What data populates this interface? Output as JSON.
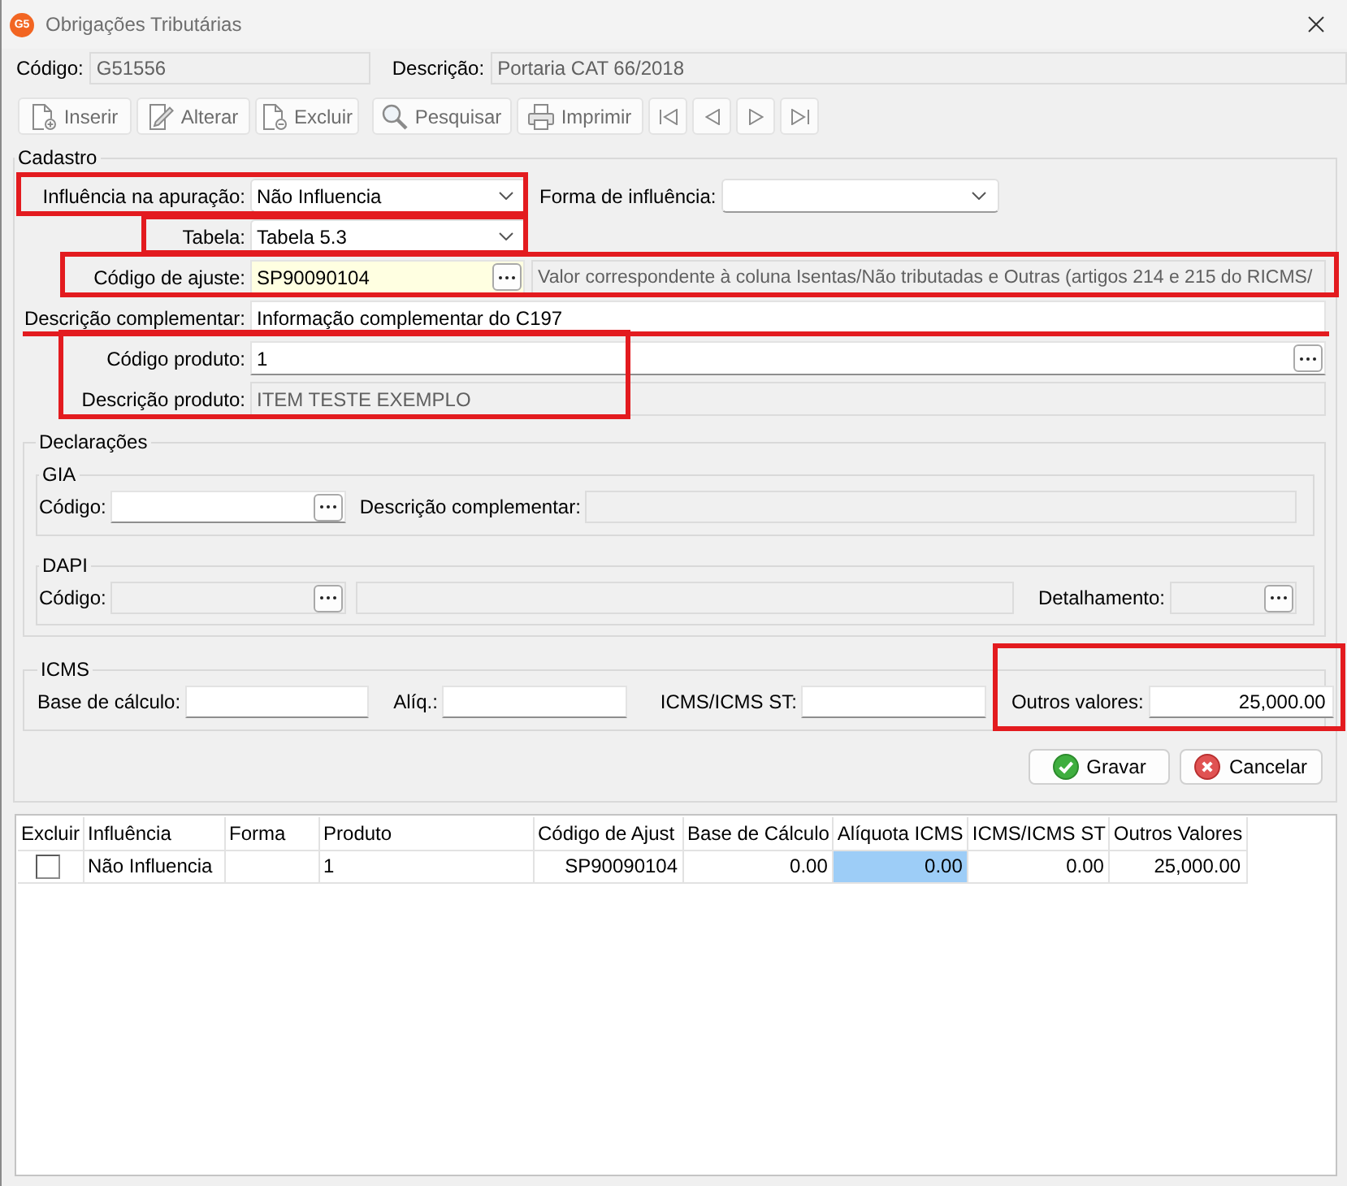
{
  "window": {
    "logo": "G5",
    "title": "Obrigações Tributárias"
  },
  "header": [
    {
      "label": "Código:",
      "value": "G51556",
      "disabled": true
    },
    {
      "label": "Descrição:",
      "value": "Portaria CAT 66/2018",
      "disabled": true
    }
  ],
  "toolbar": [
    {
      "kind": "insert",
      "label": "Inserir",
      "disabled": true
    },
    {
      "kind": "edit",
      "label": "Alterar",
      "disabled": true
    },
    {
      "kind": "delete",
      "label": "Excluir",
      "disabled": true
    },
    {
      "kind": "search",
      "label": "Pesquisar",
      "disabled": true
    },
    {
      "kind": "print",
      "label": "Imprimir",
      "disabled": true
    },
    {
      "kind": "first",
      "disabled": true
    },
    {
      "kind": "previous",
      "disabled": true
    },
    {
      "kind": "next",
      "disabled": true
    },
    {
      "kind": "last",
      "disabled": true
    }
  ],
  "cadastro": {
    "title": "Cadastro",
    "influencia": {
      "label": "Influência na apuração:",
      "value": "Não Influencia",
      "highlighted": true
    },
    "forma": {
      "label": "Forma de influência:"
    },
    "tabela": {
      "label": "Tabela:",
      "value": "Tabela 5.3",
      "highlighted": true
    },
    "codigo_ajuste": {
      "label": "Código de ajuste:",
      "value": "SP90090104",
      "focused": true,
      "description": "Valor correspondente à coluna Isentas/Não tributadas e Outras (artigos 214 e 215 do RICMS/",
      "highlighted": true
    },
    "descricao_complementar": {
      "label": "Descrição complementar:",
      "value": "Informação complementar do C197",
      "disabled": false,
      "highlighted": true
    },
    "produto": {
      "highlighted": true,
      "codigo": {
        "label": "Código produto:",
        "value": "1",
        "disabled": false
      },
      "descricao": {
        "label": "Descrição produto:",
        "value": "ITEM TESTE EXEMPLO",
        "disabled": true
      }
    },
    "declaracoes": {
      "title": "Declarações",
      "gia": {
        "title": "GIA",
        "codigo": {
          "label": "Código:",
          "disabled": false
        },
        "descricao": {
          "label": "Descrição complementar:",
          "disabled": true
        }
      },
      "dapi": {
        "title": "DAPI",
        "codigo": {
          "label": "Código:",
          "disabled": true
        },
        "detalhe": {
          "disabled": true
        },
        "detalhamento": {
          "label": "Detalhamento:",
          "disabled": true
        }
      }
    },
    "icms": {
      "title": "ICMS",
      "fields": [
        {
          "label": "Base de cálculo:",
          "disabled": false,
          "highlighted": false
        },
        {
          "label": "Alíq.:",
          "disabled": false,
          "highlighted": false
        },
        {
          "label": "ICMS/ICMS ST:",
          "disabled": false,
          "highlighted": false
        },
        {
          "label": "Outros valores:",
          "value": "25,000.00",
          "disabled": false,
          "highlighted": true
        }
      ]
    },
    "actions": [
      {
        "kind": "save",
        "label": "Gravar"
      },
      {
        "kind": "cancel",
        "label": "Cancelar"
      }
    ]
  },
  "table": {
    "columns": [
      "Excluir",
      "Influência",
      "Forma",
      "Produto",
      "Código de Ajust",
      "Base de Cálculo",
      "Alíquota ICMS",
      "ICMS/ICMS ST",
      "Outros Valores"
    ],
    "rows": [
      {
        "cells": [
          {
            "kind": "checkbox",
            "checked": false,
            "selected": false
          },
          {
            "kind": "text",
            "text": "Não Influencia",
            "selected": false
          },
          {
            "kind": "text",
            "selected": false
          },
          {
            "kind": "text",
            "text": "1",
            "selected": false
          },
          {
            "kind": "text",
            "text": "SP90090104",
            "selected": false
          },
          {
            "kind": "text",
            "text": "0.00",
            "selected": false
          },
          {
            "kind": "text",
            "text": "0.00",
            "selected": true
          },
          {
            "kind": "text",
            "text": "0.00",
            "selected": false
          },
          {
            "kind": "text",
            "text": "25,000.00",
            "selected": false
          }
        ]
      }
    ]
  }
}
